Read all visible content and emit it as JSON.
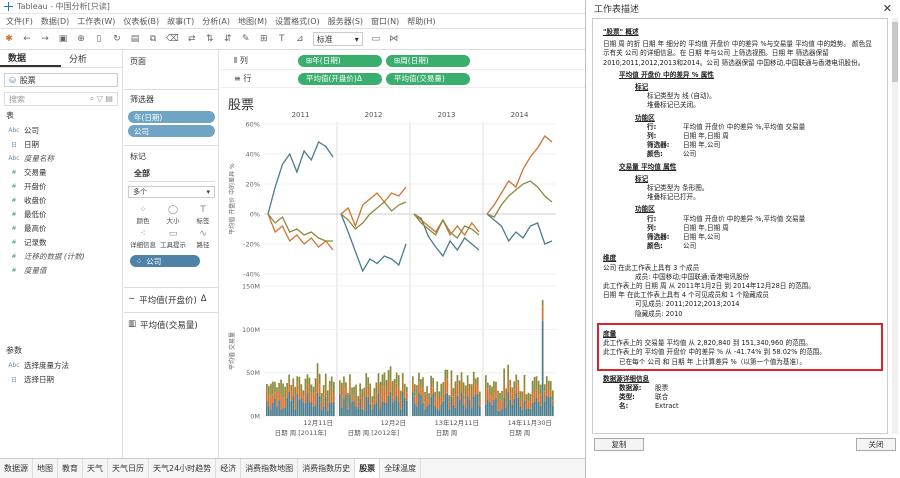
{
  "window": {
    "title": "Tableau - 中国分析[只读]"
  },
  "menu": [
    "文件(F)",
    "数据(D)",
    "工作表(W)",
    "仪表板(B)",
    "故事(T)",
    "分析(A)",
    "地图(M)",
    "设置格式(O)",
    "服务器(S)",
    "窗口(N)",
    "帮助(H)"
  ],
  "toolbar": {
    "show_me": "标准"
  },
  "left_tabs": [
    "数据",
    "分析"
  ],
  "datasource": "股票",
  "search_placeholder": "搜索",
  "tables_header": "表",
  "fields": [
    {
      "type": "Abc",
      "name": "公司",
      "italic": false
    },
    {
      "type": "日",
      "name": "日期",
      "italic": false
    },
    {
      "type": "Abc",
      "name": "度量名称",
      "italic": true
    },
    {
      "type": "#",
      "name": "交易量",
      "italic": false
    },
    {
      "type": "#",
      "name": "开盘价",
      "italic": false
    },
    {
      "type": "#",
      "name": "收盘价",
      "italic": false
    },
    {
      "type": "#",
      "name": "最低价",
      "italic": false
    },
    {
      "type": "#",
      "name": "最高价",
      "italic": false
    },
    {
      "type": "#",
      "name": "记录数",
      "italic": false
    },
    {
      "type": "#",
      "name": "迁移的数据 (计数)",
      "italic": true
    },
    {
      "type": "#",
      "name": "度量值",
      "italic": true
    }
  ],
  "params_header": "参数",
  "params": [
    {
      "type": "Abc",
      "name": "选择度量方法"
    },
    {
      "type": "日",
      "name": "选择日期"
    }
  ],
  "cards": {
    "pages": "页面",
    "filters": "筛选器",
    "filter_pills": [
      "年(日期)",
      "公司"
    ],
    "marks": "标记",
    "marks_all": "全部",
    "mark_type": "多个",
    "mark_buttons": [
      {
        "icon": "color-icon",
        "glyph": "⁘",
        "label": "颜色"
      },
      {
        "icon": "size-icon",
        "glyph": "◯",
        "label": "大小"
      },
      {
        "icon": "label-icon",
        "glyph": "T",
        "label": "标签"
      },
      {
        "icon": "detail-icon",
        "glyph": "⁖",
        "label": "详细信息"
      },
      {
        "icon": "tooltip-icon",
        "glyph": "▭",
        "label": "工具提示"
      },
      {
        "icon": "path-icon",
        "glyph": "∿",
        "label": "路径"
      }
    ],
    "marks_pill": "公司",
    "measure_cards": [
      "平均值(开盘价)",
      "平均值(交易量)"
    ]
  },
  "shelves": {
    "columns_label": "列",
    "columns_pills": [
      "年(日期)",
      "周(日期)"
    ],
    "rows_label": "行",
    "rows_pills": [
      "平均值(开盘价)",
      "平均值(交易量)"
    ]
  },
  "sheet_title": "股票",
  "chart_data": {
    "type": "line",
    "years": [
      "2011",
      "2012",
      "2013",
      "2014"
    ],
    "top": {
      "ylabel": "平均值 开盘价 中的差异 %",
      "ylim": [
        -40,
        60
      ],
      "ticks": [
        "60%",
        "40%",
        "20%",
        "0%",
        "-20%",
        "-40%"
      ],
      "series": [
        {
          "name": "blue",
          "color": "#4a7c8c",
          "values": [
            [
              0,
              18,
              33,
              40,
              28,
              42,
              36,
              48,
              45,
              38
            ],
            [
              0,
              -12,
              -25,
              -38,
              -30,
              -33,
              -28,
              -30,
              -34,
              -20
            ],
            [
              0,
              -3,
              -15,
              -22,
              -28,
              -18,
              -24,
              -16,
              -20,
              -24
            ],
            [
              0,
              -4,
              -8,
              -18,
              -12,
              -16,
              -8,
              -6,
              -20,
              -18
            ]
          ]
        },
        {
          "name": "orange",
          "color": "#d2722f",
          "values": [
            [
              0,
              -12,
              -8,
              -18,
              -14,
              -20,
              -16,
              -22,
              -18,
              -24
            ],
            [
              0,
              4,
              -8,
              6,
              10,
              14,
              8,
              14,
              12,
              18
            ],
            [
              0,
              -4,
              -8,
              -12,
              -4,
              -14,
              -8,
              -14,
              -6,
              -12
            ],
            [
              0,
              6,
              14,
              22,
              18,
              30,
              38,
              44,
              52,
              48
            ]
          ]
        },
        {
          "name": "olive",
          "color": "#8a8a3c",
          "values": [
            [
              0,
              -6,
              -2,
              -12,
              -10,
              -14,
              -12,
              -16,
              -18,
              -18
            ],
            [
              0,
              -4,
              -10,
              -6,
              0,
              4,
              8,
              2,
              6,
              8
            ],
            [
              0,
              -6,
              -10,
              -14,
              -4,
              -12,
              -16,
              -8,
              -10,
              -14
            ],
            [
              0,
              -2,
              6,
              12,
              16,
              20,
              22,
              18,
              12,
              8
            ]
          ]
        }
      ]
    },
    "bottom": {
      "ylabel": "平均值 交易量",
      "ylim": [
        0,
        150
      ],
      "ticks": [
        "150M",
        "100M",
        "50M",
        "0M"
      ]
    },
    "x_ticks": [
      "12月11日",
      "12月2日",
      "13年12月11日",
      "14年11月30日"
    ],
    "x_label": [
      "日期 周 [2011年]",
      "日期 周 [2012年]",
      "日期 周",
      "日期 周"
    ]
  },
  "sheet_tabs": [
    "数据源",
    "地图",
    "教育",
    "天气",
    "天气日历",
    "天气24小时趋势",
    "经济",
    "消费指数地图",
    "消费指数历史",
    "股票",
    "全球温度"
  ],
  "active_tab": "股票",
  "dialog": {
    "title": "工作表描述",
    "heading": "\"股票\" 概述",
    "intro": "日期 周 的折 日期 年 细分的 平均值 开盘价 中的差异 %与交易量 平均值 中的趋势。 颜色显示有关 公司 的详细信息。在 日期 年与公司 上筛选视图。日期 年 筛选器保留 2010,2011,2012,2013和2014。公司 筛选器保留 中国移动,中国联通与香港电讯股份。",
    "sections": [
      {
        "h": "平均值 开盘价 中的差异 % 属性",
        "label_h": "标记",
        "label1": "标记类型为 线 (自动)。",
        "label2": "堆叠标记已关闭。",
        "func_h": "功能区",
        "rows": [
          [
            "行:",
            "平均值 开盘价 中的差异 %,平均值 交易量"
          ],
          [
            "列:",
            "日期 年,日期 周"
          ],
          [
            "筛选器:",
            "日期 年,公司"
          ],
          [
            "颜色:",
            "公司"
          ]
        ]
      },
      {
        "h": "交易量 平均值 属性",
        "label_h": "标记",
        "label1": "标记类型为 条形图。",
        "label2": "堆叠标记已打开。",
        "func_h": "功能区",
        "rows": [
          [
            "行:",
            "平均值 开盘价 中的差异 %,平均值 交易量"
          ],
          [
            "列:",
            "日期 年,日期 周"
          ],
          [
            "筛选器:",
            "日期 年,公司"
          ],
          [
            "颜色:",
            "公司"
          ]
        ]
      }
    ],
    "dims_h": "维度",
    "dims": [
      "公司 在此工作表上具有 3 个成员",
      "成员: 中国移动;中国联通;香港电讯股份",
      "此工作表上的 日期 周 从 2011年1月2日 到 2014年12月28日 的范围。",
      "日期 年 在此工作表上具有 4 个可见成员和 1 个隐藏成员",
      "可见成员: 2011;2012;2013;2014",
      "隐藏成员: 2010"
    ],
    "measures_h": "度量",
    "measures": [
      "此工作表上的 交易量 平均值 从 2,820,840 到 151,340,960 的范围。",
      "此工作表上的 平均值 开盘价 中的差异 % 从 -41.74% 到 58.02% 的范围。",
      "已在每个 公司 和 日期 年 上计算差异 %（以第一个值为基准）。"
    ],
    "ds_h": "数据源详细信息",
    "ds": [
      [
        "数据源:",
        "股票"
      ],
      [
        "类型:",
        "联合"
      ],
      [
        "名:",
        "Extract"
      ]
    ],
    "copy": "复制",
    "close": "关闭"
  }
}
